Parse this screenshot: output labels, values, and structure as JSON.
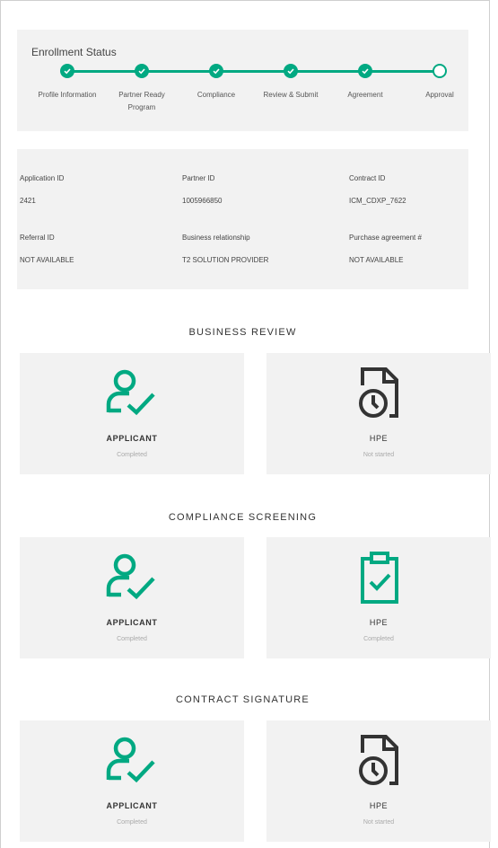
{
  "enrollment": {
    "title": "Enrollment Status",
    "steps": [
      {
        "label": "Profile Information",
        "completed": true
      },
      {
        "label": "Partner Ready Program",
        "completed": true
      },
      {
        "label": "Compliance",
        "completed": true
      },
      {
        "label": "Review & Submit",
        "completed": true
      },
      {
        "label": "Agreement",
        "completed": true
      },
      {
        "label": "Approval",
        "completed": false
      }
    ]
  },
  "info": {
    "application_id_label": "Application ID",
    "application_id": "2421",
    "partner_id_label": "Partner ID",
    "partner_id": "1005966850",
    "contract_id_label": "Contract ID",
    "contract_id": "ICM_CDXP_7622",
    "referral_id_label": "Referral ID",
    "referral_id": "NOT AVAILABLE",
    "business_relationship_label": "Business relationship",
    "business_relationship": "T2 SOLUTION PROVIDER",
    "purchase_agreement_label": "Purchase agreement #",
    "purchase_agreement": "NOT AVAILABLE"
  },
  "sections": [
    {
      "title": "BUSINESS REVIEW",
      "applicant": {
        "role": "APPLICANT",
        "status": "Completed",
        "icon": "user-check-icon"
      },
      "hpe": {
        "role": "HPE",
        "status": "Not started",
        "icon": "document-clock-icon"
      }
    },
    {
      "title": "COMPLIANCE SCREENING",
      "applicant": {
        "role": "APPLICANT",
        "status": "Completed",
        "icon": "user-check-icon"
      },
      "hpe": {
        "role": "HPE",
        "status": "Completed",
        "icon": "clipboard-check-icon"
      }
    },
    {
      "title": "CONTRACT SIGNATURE",
      "applicant": {
        "role": "APPLICANT",
        "status": "Completed",
        "icon": "user-check-icon"
      },
      "hpe": {
        "role": "HPE",
        "status": "Not started",
        "icon": "document-clock-icon"
      }
    }
  ],
  "colors": {
    "accent": "#01a982",
    "panel": "#f2f2f2",
    "icon_dark": "#333333",
    "muted_text": "#aaaaaa"
  }
}
